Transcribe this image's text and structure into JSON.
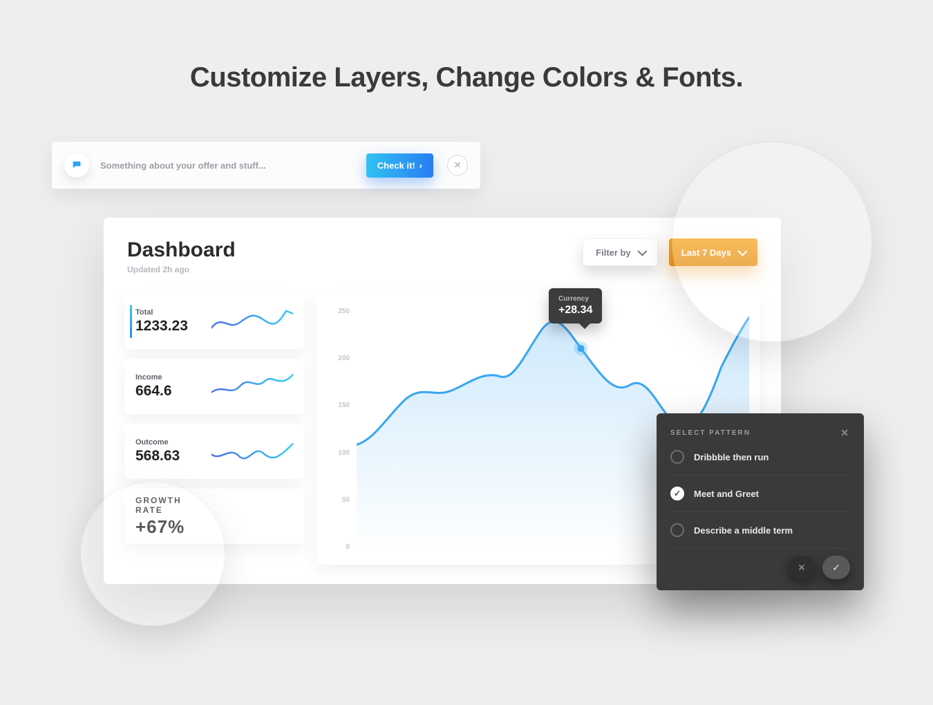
{
  "hero": "Customize Layers, Change Colors & Fonts.",
  "notif": {
    "message": "Something about your offer and stuff...",
    "cta": "Check it!"
  },
  "dashboard": {
    "title": "Dashboard",
    "subtitle": "Updated 2h ago",
    "filter_label": "Filter by",
    "range_label": "Last 7 Days"
  },
  "cards": [
    {
      "label": "Total",
      "value": "1233.23"
    },
    {
      "label": "Income",
      "value": "664.6"
    },
    {
      "label": "Outcome",
      "value": "568.63"
    },
    {
      "label": "GROWTH RATE",
      "value": "+67%"
    }
  ],
  "tooltip": {
    "label": "Currency",
    "value": "+28.34"
  },
  "pattern": {
    "title": "SELECT PATTERN",
    "options": [
      {
        "label": "Dribbble then run",
        "selected": false
      },
      {
        "label": "Meet and Greet",
        "selected": true
      },
      {
        "label": "Describe a middle term",
        "selected": false
      }
    ]
  },
  "chart_data": {
    "type": "line",
    "ylabel": "",
    "ylim": [
      0,
      250
    ],
    "yticks": [
      250,
      200,
      150,
      100,
      50,
      0
    ],
    "series": [
      {
        "name": "Currency",
        "color": "#3aa6f2",
        "values": [
          110,
          115,
          140,
          160,
          158,
          165,
          175,
          170,
          210,
          235,
          225,
          208,
          190,
          175,
          160,
          170,
          155,
          145,
          165,
          195,
          215,
          238
        ]
      }
    ],
    "highlight": {
      "index": 11,
      "value": 208,
      "label": "+28.34"
    }
  }
}
